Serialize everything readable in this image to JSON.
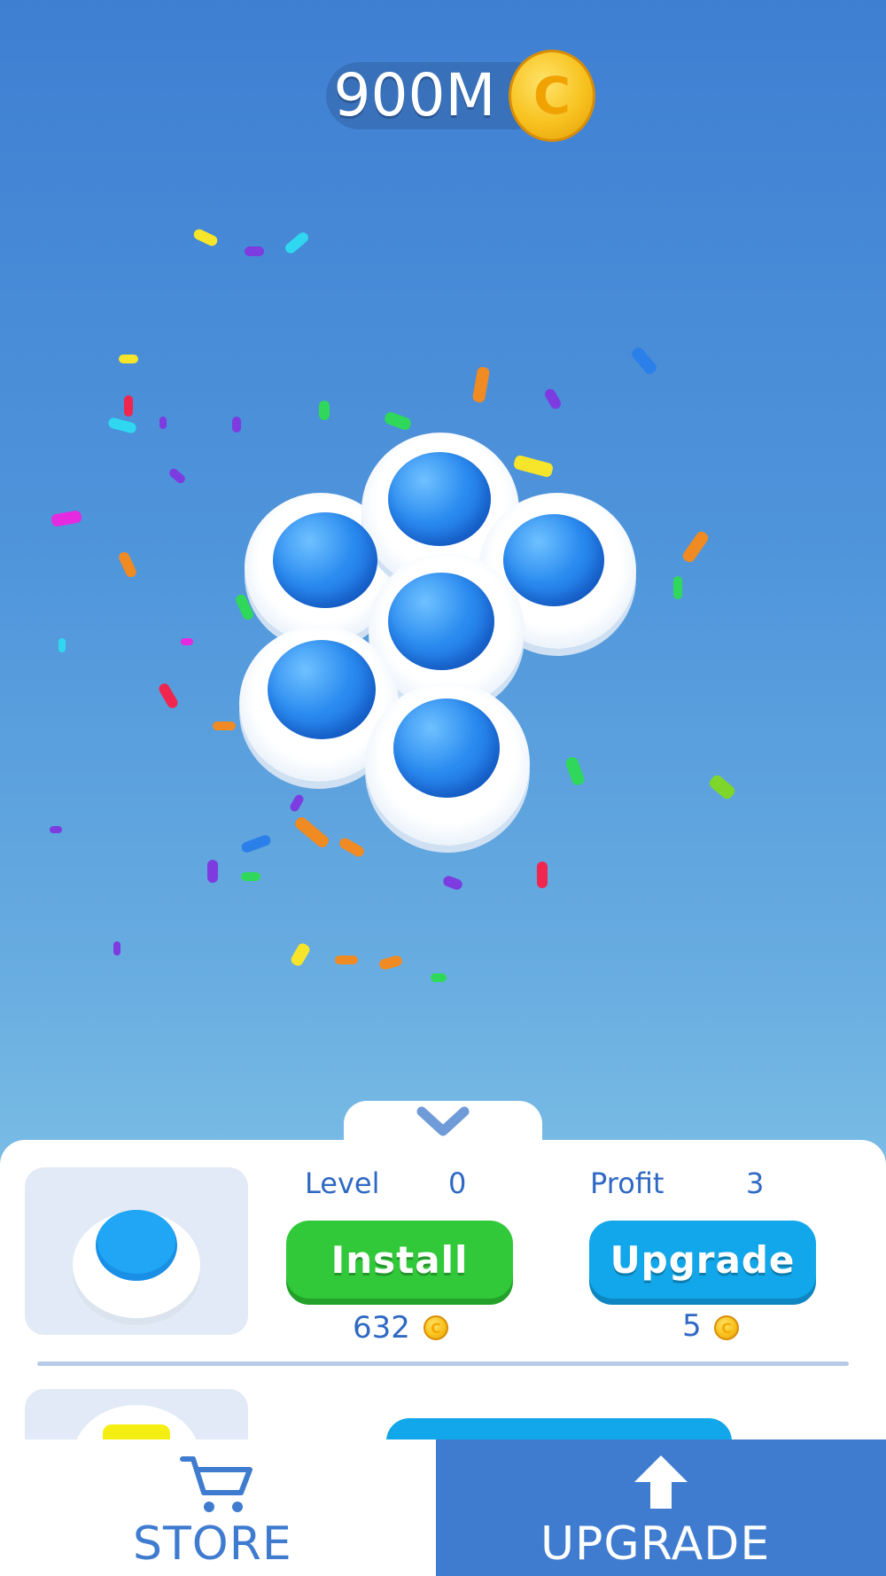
{
  "hud": {
    "currency_amount": "900M",
    "currency_icon": "coin-icon",
    "coin_symbol": "C"
  },
  "panel": {
    "item": {
      "thumbnail_icon": "blue-pop-button-icon",
      "level_label": "Level",
      "level_value": "0",
      "profit_label": "Profit",
      "profit_value": "3",
      "install_label": "Install",
      "install_price": "632",
      "upgrade_label": "Upgrade",
      "upgrade_price": "5"
    }
  },
  "nav": {
    "store_label": "STORE",
    "store_icon": "cart-icon",
    "upgrade_label": "UPGRADE",
    "upgrade_icon": "arrow-up-icon",
    "active_tab": "UPGRADE"
  },
  "colors": {
    "install": "#31c93a",
    "upgrade": "#12a7ea",
    "nav_active": "#3f7cd0",
    "label_text": "#2f69c4"
  }
}
